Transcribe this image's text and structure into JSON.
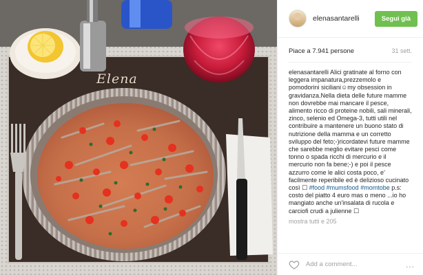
{
  "post": {
    "photo": {
      "placemat_text": "Elena",
      "description": "tart of baked anchovies with tomatoes and parsley"
    },
    "header": {
      "username": "elenasantarelli",
      "follow_label": "Segui già"
    },
    "likes_text": "Piace a 7.941 persone",
    "time_ago": "31 sett.",
    "caption": {
      "username": "elenasantarelli",
      "text": "Alici gratinate al forno con leggera impanatura,prezzemolo e pomodorini siciliani☺my obsession in gravidanza.Nella dieta delle future mamme non dovrebbe mai mancare il pesce, alimento ricco di proteine nobili, sali minerali, zinco, selenio ed Omega-3, tutti utili nel contribuire a mantenere un buono stato di nutrizione della mamma e un corretto sviluppo del feto;-)ricordatevi future mamme che sarebbe meglio evitare pesci come tonno o spada ricchi di mercurio e il mercurio non fa bene;-) e poi il pesce azzurro come le alici costa poco, e' facilmente reperibile ed è delizioso cucinato così ☐",
      "hashtags": [
        "#food",
        "#mumsfood",
        "#momtobe"
      ],
      "tail_text": "p.s: costo del piatto 4 euro mas o meno ...io ho mangiato anche un'insalata di rucola e carciofi crudi a julienne ☐"
    },
    "more_comments": "mostra tutti e 205",
    "comment_placeholder": "Add a comment...",
    "more_options": "...",
    "icons": {
      "like": "heart-icon",
      "options": "more-options-icon"
    },
    "colors": {
      "follow_button": "#70c050",
      "hashtag": "#125688",
      "muted": "#a0a0a0"
    }
  }
}
